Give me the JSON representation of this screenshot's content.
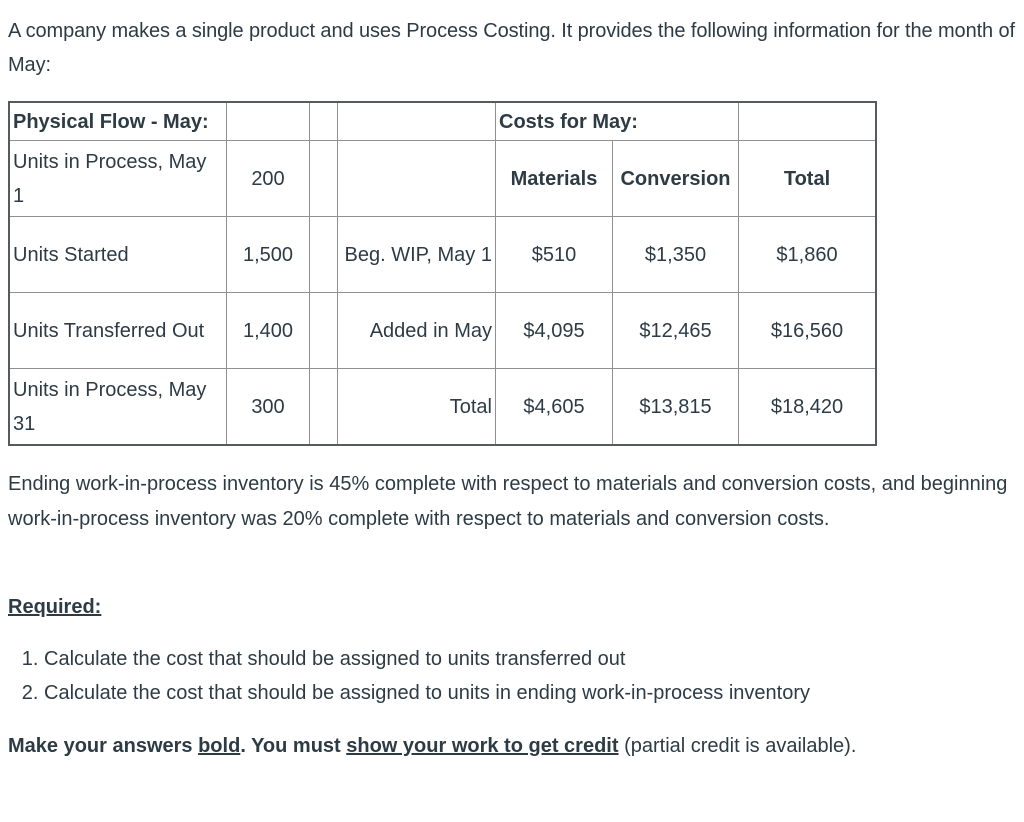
{
  "intro": "A company makes a single product and uses Process Costing.  It provides the following information for the month of May:",
  "table": {
    "header": {
      "physical_flow": "Physical Flow - May:",
      "costs_for_may": "Costs for May:"
    },
    "cost_columns": [
      "Materials",
      "Conversion",
      "Total"
    ],
    "rows": [
      {
        "label": "Units in Process, May 1",
        "units": "200",
        "cost_label": "",
        "materials": "",
        "conversion": "",
        "total": ""
      },
      {
        "label": "Units Started",
        "units": "1,500",
        "cost_label": "Beg. WIP, May 1",
        "materials": "$510",
        "conversion": "$1,350",
        "total": "$1,860"
      },
      {
        "label": "Units Transferred Out",
        "units": "1,400",
        "cost_label": "Added in May",
        "materials": "$4,095",
        "conversion": "$12,465",
        "total": "$16,560"
      },
      {
        "label": "Units in Process, May 31",
        "units": "300",
        "cost_label": "Total",
        "materials": "$4,605",
        "conversion": "$13,815",
        "total": "$18,420"
      }
    ]
  },
  "completion_text": " Ending work-in-process inventory is 45% complete with respect to materials and conversion costs, and beginning work-in-process inventory was 20% complete with respect to materials and conversion costs.",
  "required_label": "Required:",
  "tasks": [
    "Calculate the cost that should be assigned to units transferred out",
    "Calculate the cost that should be assigned to units in ending work-in-process inventory"
  ],
  "closing": {
    "part1": "Make your answers ",
    "bold_word": "bold",
    "part2": ".  You must ",
    "show_work": "show your work to get credit",
    "part3": " (partial credit is available)."
  }
}
